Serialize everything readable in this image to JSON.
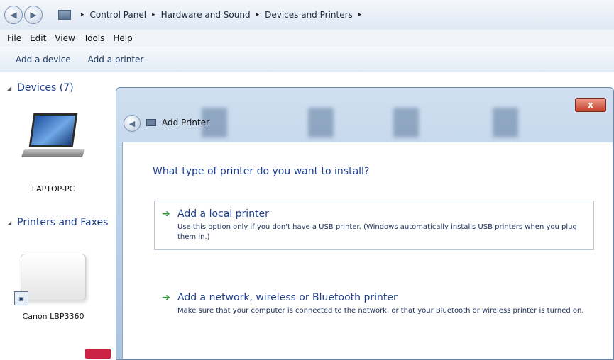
{
  "address_bar": {
    "breadcrumbs": [
      "Control Panel",
      "Hardware and Sound",
      "Devices and Printers"
    ],
    "separator": "▸"
  },
  "menu": {
    "items": [
      "File",
      "Edit",
      "View",
      "Tools",
      "Help"
    ]
  },
  "command_bar": {
    "add_device": "Add a device",
    "add_printer": "Add a printer"
  },
  "devices": {
    "header": "Devices (7)",
    "items": [
      {
        "label": "LAPTOP-PC",
        "icon": "laptop-icon"
      }
    ]
  },
  "printers": {
    "header": "Printers and Faxes",
    "items": [
      {
        "label": "Canon LBP3360",
        "icon": "printer-icon"
      }
    ]
  },
  "dialog": {
    "title": "Add Printer",
    "close": "x",
    "question": "What type of printer do you want to install?",
    "options": [
      {
        "title": "Add a local printer",
        "description": "Use this option only if you don't have a USB printer. (Windows automatically installs USB printers when you plug them in.)"
      },
      {
        "title": "Add a network, wireless or Bluetooth printer",
        "description": "Make sure that your computer is connected to the network, or that your Bluetooth or wireless printer is turned on."
      }
    ]
  },
  "colors": {
    "link_blue": "#1e3f8d",
    "arrow_green": "#2f9e3a",
    "close_red": "#c2412a"
  }
}
